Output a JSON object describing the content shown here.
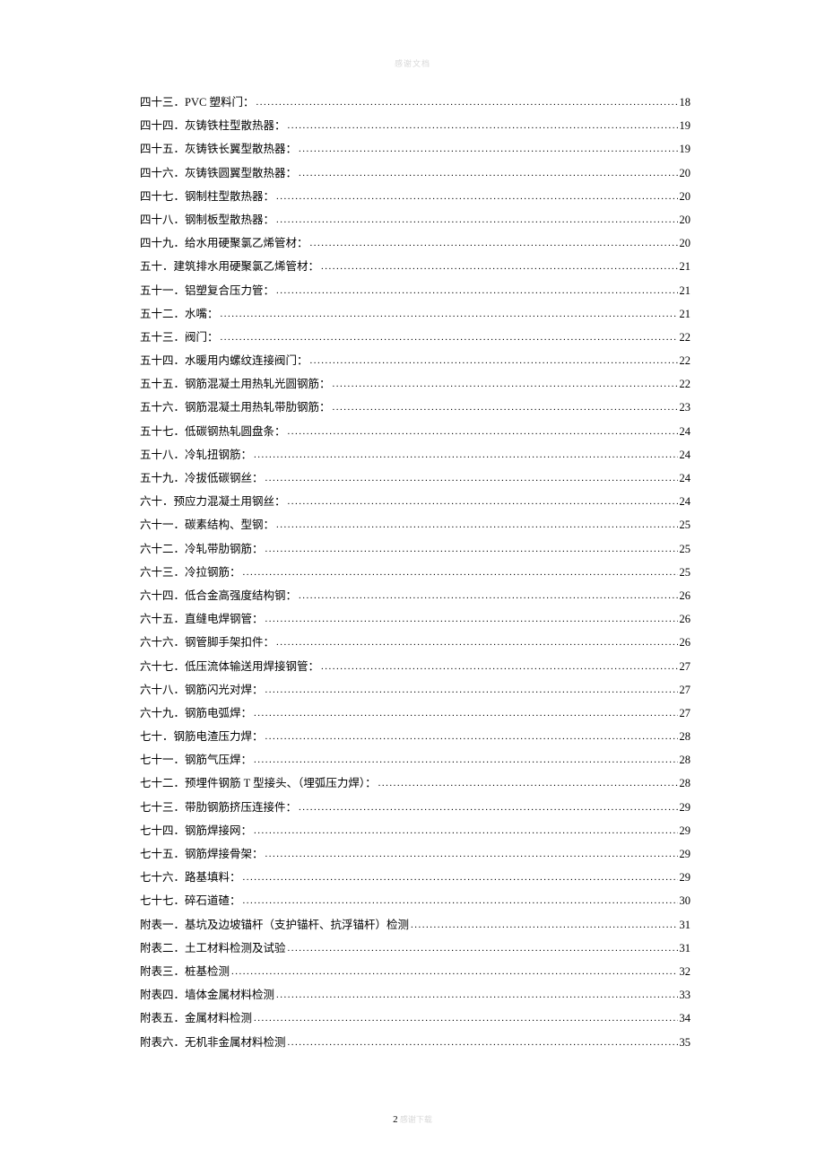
{
  "header_watermark": "感谢文档",
  "footer": {
    "page_number": "2",
    "suffix": " 感谢下载"
  },
  "toc": [
    {
      "num": "四十三．",
      "title": "PVC 塑料门：",
      "page": "18"
    },
    {
      "num": "四十四．",
      "title": "灰铸铁柱型散热器：",
      "page": "19"
    },
    {
      "num": "四十五．",
      "title": "灰铸铁长翼型散热器：",
      "page": "19"
    },
    {
      "num": "四十六．",
      "title": "灰铸铁圆翼型散热器：",
      "page": "20"
    },
    {
      "num": "四十七．",
      "title": "钢制柱型散热器：",
      "page": "20"
    },
    {
      "num": "四十八．",
      "title": "钢制板型散热器：",
      "page": "20"
    },
    {
      "num": "四十九．",
      "title": "给水用硬聚氯乙烯管材：",
      "page": "20"
    },
    {
      "num": "五十．",
      "title": "建筑排水用硬聚氯乙烯管材：",
      "page": "21"
    },
    {
      "num": "五十一．",
      "title": "铝塑复合压力管：",
      "page": "21"
    },
    {
      "num": "五十二．",
      "title": "水嘴：",
      "page": "21"
    },
    {
      "num": "五十三．",
      "title": "阀门：",
      "page": "22"
    },
    {
      "num": "五十四．",
      "title": "水暖用内螺纹连接阀门：",
      "page": "22"
    },
    {
      "num": "五十五．",
      "title": "钢筋混凝土用热轧光圆钢筋：",
      "page": "22"
    },
    {
      "num": "五十六．",
      "title": "钢筋混凝土用热轧带肋钢筋：",
      "page": "23"
    },
    {
      "num": "五十七．",
      "title": "低碳钢热轧圆盘条：",
      "page": "24"
    },
    {
      "num": "五十八．",
      "title": "冷轧扭钢筋：",
      "page": "24"
    },
    {
      "num": "五十九．",
      "title": "冷拔低碳钢丝：",
      "page": "24"
    },
    {
      "num": "六十．",
      "title": "预应力混凝土用钢丝：",
      "page": "24"
    },
    {
      "num": "六十一．",
      "title": "碳素结构、型钢：",
      "page": "25"
    },
    {
      "num": "六十二．",
      "title": "冷轧带肋钢筋：",
      "page": "25"
    },
    {
      "num": "六十三．",
      "title": "冷拉钢筋：",
      "page": "25"
    },
    {
      "num": "六十四．",
      "title": "低合金高强度结构钢：",
      "page": "26"
    },
    {
      "num": "六十五．",
      "title": "直缝电焊钢管：",
      "page": "26"
    },
    {
      "num": "六十六．",
      "title": "钢管脚手架扣件：",
      "page": "26"
    },
    {
      "num": "六十七．",
      "title": "低压流体输送用焊接钢管：",
      "page": "27"
    },
    {
      "num": "六十八．",
      "title": "钢筋闪光对焊：",
      "page": "27"
    },
    {
      "num": "六十九．",
      "title": "钢筋电弧焊：",
      "page": "27"
    },
    {
      "num": "七十．",
      "title": "钢筋电渣压力焊：",
      "page": "28"
    },
    {
      "num": "七十一．",
      "title": "钢筋气压焊：",
      "page": "28"
    },
    {
      "num": "七十二．",
      "title": "预埋件钢筋 T 型接头、（埋弧压力焊）：",
      "page": "28"
    },
    {
      "num": "七十三．",
      "title": "带肋钢筋挤压连接件：",
      "page": "29"
    },
    {
      "num": "七十四．",
      "title": "钢筋焊接网：",
      "page": "29"
    },
    {
      "num": "七十五．",
      "title": "钢筋焊接骨架：",
      "page": "29"
    },
    {
      "num": "七十六．",
      "title": "路基填料：",
      "page": "29"
    },
    {
      "num": "七十七．",
      "title": "碎石道碴：",
      "page": "30"
    },
    {
      "num": "附表一．",
      "title": "基坑及边坡锚杆（支护锚杆、抗浮锚杆）检测",
      "page": "31"
    },
    {
      "num": "附表二．",
      "title": "土工材料检测及试验",
      "page": "31"
    },
    {
      "num": "附表三．",
      "title": "桩基检测",
      "page": "32"
    },
    {
      "num": "附表四．",
      "title": "墙体金属材料检测",
      "page": "33"
    },
    {
      "num": "附表五．",
      "title": "金属材料检测",
      "page": "34"
    },
    {
      "num": "附表六．",
      "title": "无机非金属材料检测",
      "page": "35"
    }
  ]
}
